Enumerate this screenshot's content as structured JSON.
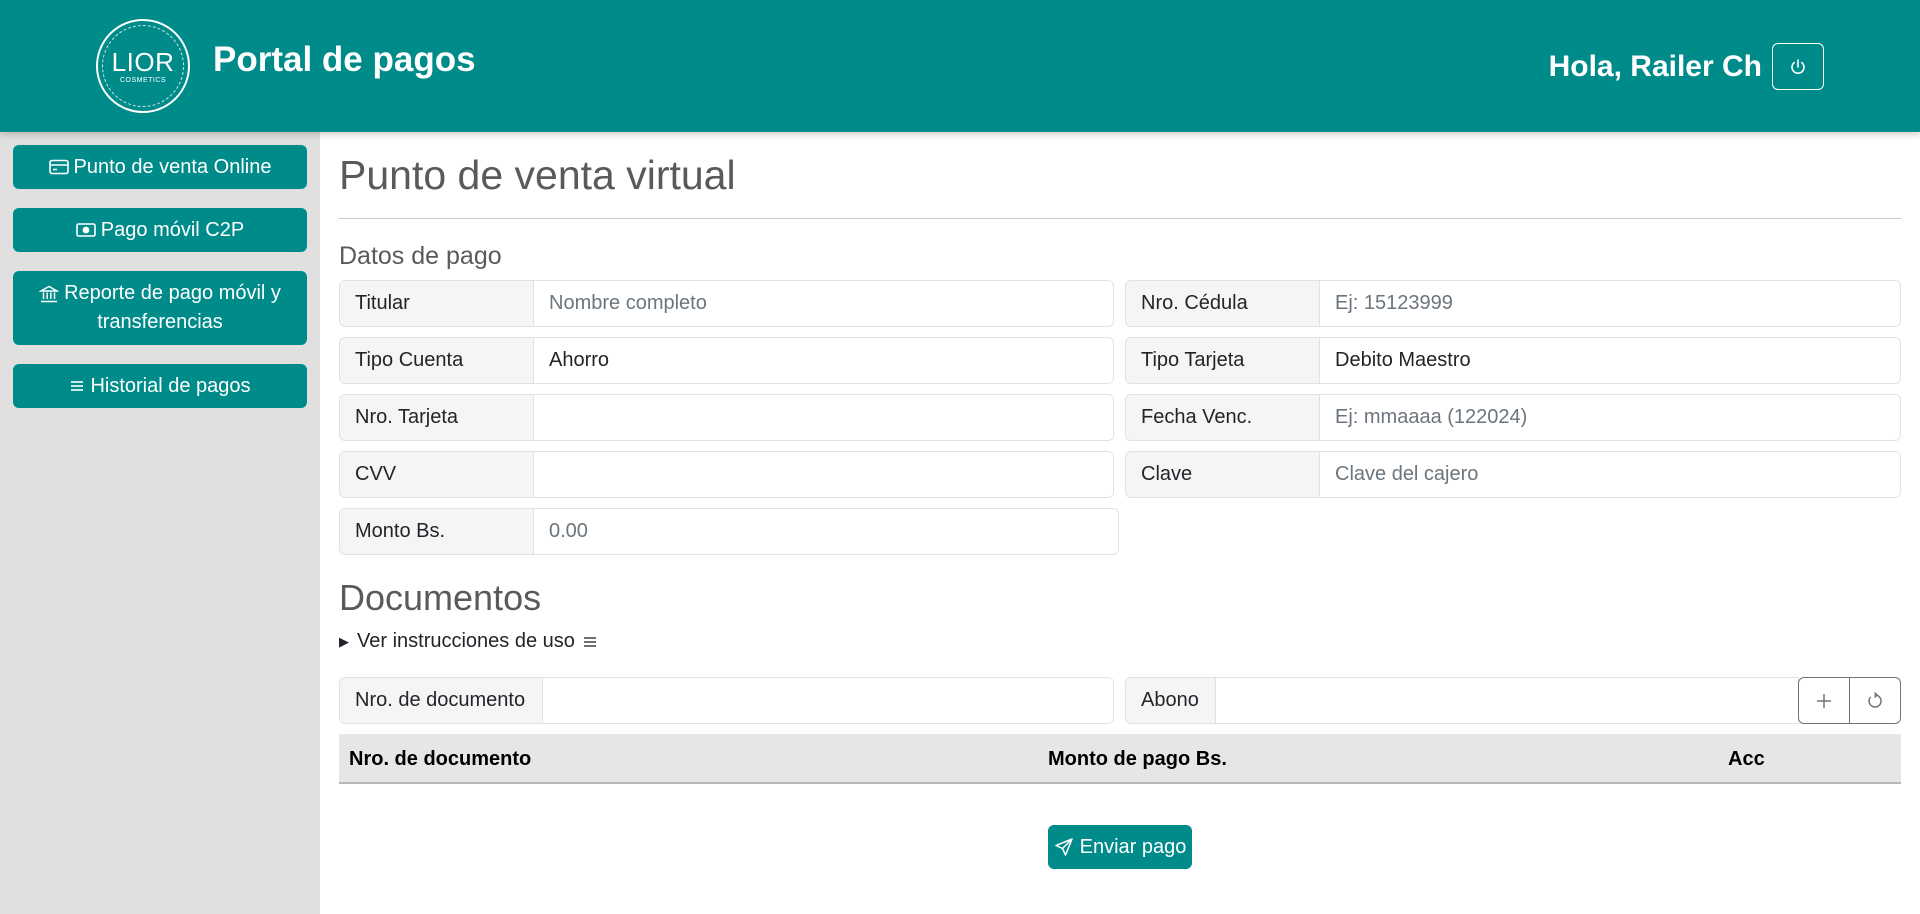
{
  "header": {
    "logo_text": "LIOR",
    "logo_subtext": "COSMETICS",
    "title": "Portal de pagos",
    "greeting": "Hola, Railer Ch",
    "logout_icon": "power-icon",
    "background_color": "#008b8b"
  },
  "sidebar": {
    "items": [
      {
        "label": "Punto de venta Online",
        "icon": "card-icon"
      },
      {
        "label": "Pago móvil C2P",
        "icon": "cash-icon"
      },
      {
        "label": "Reporte de pago móvil y transferencias",
        "icon": "bank-icon"
      },
      {
        "label": "Historial de pagos",
        "icon": "list-icon"
      }
    ]
  },
  "main": {
    "title": "Punto de venta virtual",
    "payment_section_title": "Datos de pago",
    "fields": {
      "titular": {
        "label": "Titular",
        "value": "",
        "placeholder": "Nombre completo"
      },
      "cedula": {
        "label": "Nro. Cédula",
        "value": "",
        "placeholder": "Ej: 15123999"
      },
      "tipo_cuenta": {
        "label": "Tipo Cuenta",
        "value": "Ahorro",
        "placeholder": ""
      },
      "tipo_tarjeta": {
        "label": "Tipo Tarjeta",
        "value": "Debito Maestro",
        "placeholder": ""
      },
      "nro_tarjeta": {
        "label": "Nro. Tarjeta",
        "value": "",
        "placeholder": ""
      },
      "fecha_venc": {
        "label": "Fecha Venc.",
        "value": "",
        "placeholder": "Ej: mmaaaa (122024)"
      },
      "cvv": {
        "label": "CVV",
        "value": "",
        "placeholder": ""
      },
      "clave": {
        "label": "Clave",
        "value": "",
        "placeholder": "Clave del cajero"
      },
      "monto": {
        "label": "Monto Bs.",
        "value": "",
        "placeholder": "0.00"
      }
    },
    "documents": {
      "title": "Documentos",
      "instructions_label": "Ver instrucciones de uso",
      "doc_number": {
        "label": "Nro. de documento",
        "value": "",
        "placeholder": ""
      },
      "abono": {
        "label": "Abono",
        "value": "",
        "placeholder": ""
      },
      "add_icon": "plus-icon",
      "reset_icon": "reset-icon",
      "table_headers": [
        "Nro. de documento",
        "Monto de pago Bs.",
        "Acc"
      ],
      "rows": []
    },
    "send_button": {
      "label": "Enviar pago",
      "icon": "send-icon"
    }
  }
}
